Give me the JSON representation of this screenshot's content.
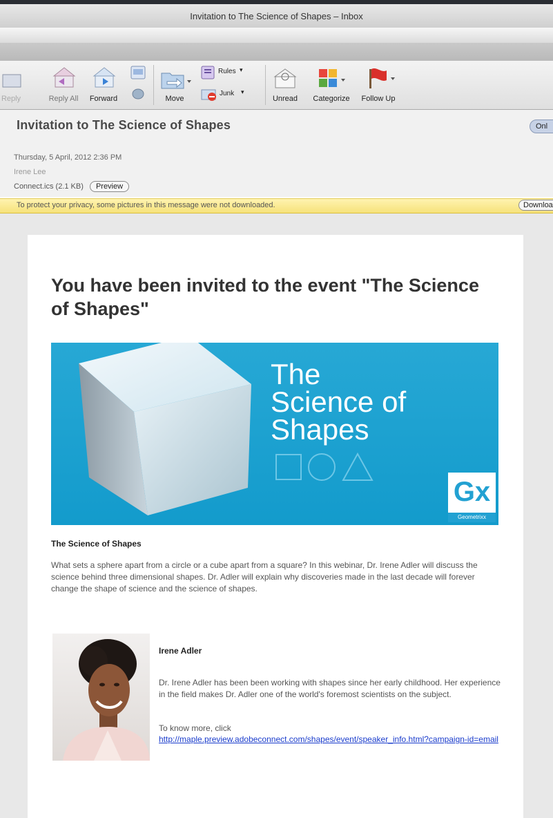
{
  "window": {
    "title": "Invitation to The Science of Shapes – Inbox"
  },
  "toolbar": {
    "reply_label": "Reply",
    "reply_all_label": "Reply All",
    "forward_label": "Forward",
    "move_label": "Move",
    "rules_label": "Rules",
    "junk_label": "Junk",
    "unread_label": "Unread",
    "categorize_label": "Categorize",
    "follow_up_label": "Follow Up"
  },
  "message": {
    "subject": "Invitation to The Science of Shapes",
    "online_label": "Onl",
    "date": "Thursday, 5 April, 2012 2:36 PM",
    "from": "Irene Lee",
    "attachment": "Connect.ics (2.1 KB)",
    "preview_label": "Preview",
    "privacy_text": "To protect your privacy, some pictures in this message were not downloaded.",
    "download_label": "Downloa"
  },
  "email": {
    "headline": "You have been invited to the event \"The Science of Shapes\"",
    "banner": {
      "line1": "The",
      "line2": "Science of",
      "line3": "Shapes",
      "logo_letters": "Gx",
      "logo_sub": "Geometrixx"
    },
    "section_title": "The Science of Shapes",
    "description": "What sets a sphere apart from a circle or a cube apart from a square? In this webinar, Dr. Irene Adler will discuss the science behind three dimensional shapes. Dr. Adler will explain why discoveries made in the last decade will forever change the shape of science and the science of shapes.",
    "speaker": {
      "name": "Irene Adler",
      "bio": "Dr. Irene Adler has been been working with shapes since her early childhood. Her experience in the field makes Dr. Adler one of the world's foremost scientists on the subject.",
      "more": "To know more, click",
      "link": "http://maple.preview.adobeconnect.com/shapes/event/speaker_info.html?campaign-id=email"
    }
  }
}
